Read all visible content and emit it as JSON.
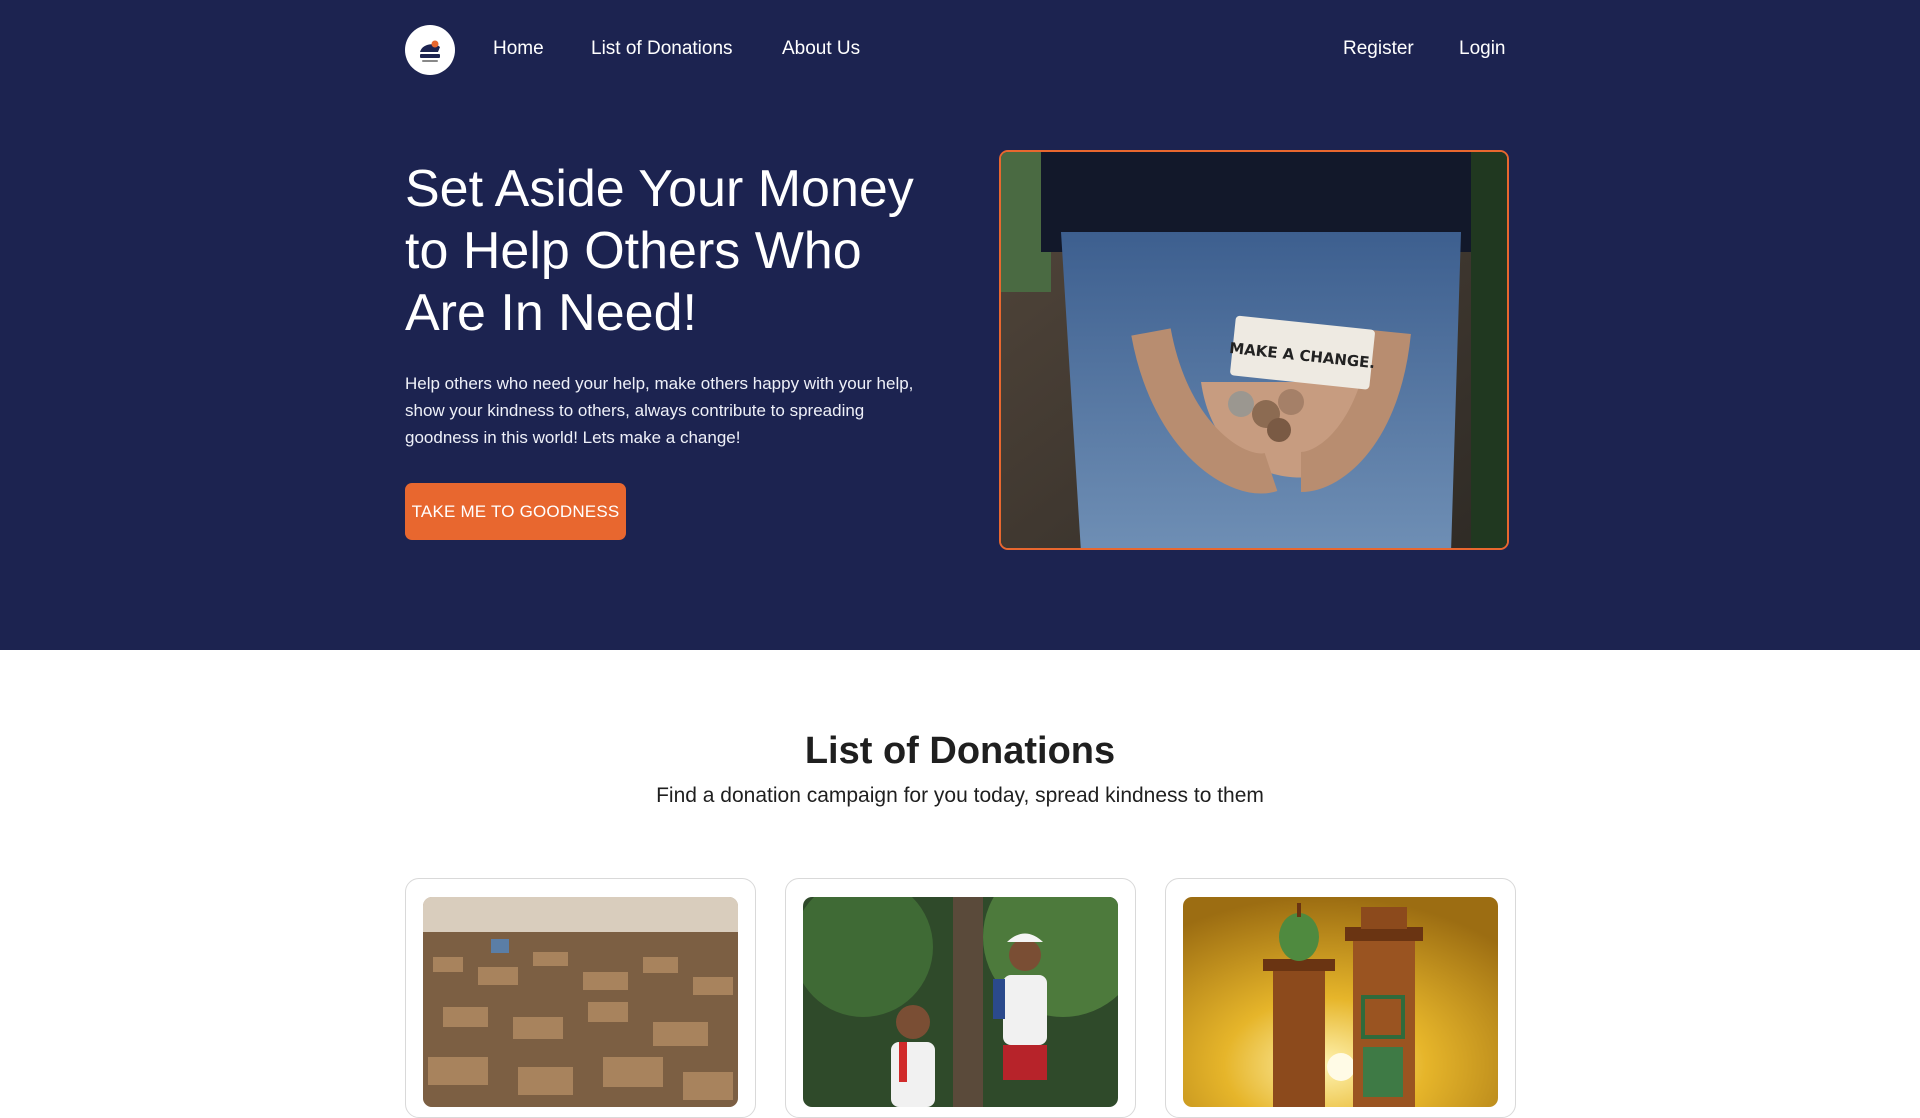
{
  "nav": {
    "logo_icon": "charity-logo-icon",
    "links": [
      "Home",
      "List of Donations",
      "About Us"
    ],
    "register": "Register",
    "login": "Login"
  },
  "hero": {
    "title": "Set Aside Your Money to Help Others Who Are In Need!",
    "description": "Help others who need your help, make others happy with your help, show your kindness to others, always contribute to spreading goodness in this world! Lets make a change!",
    "cta": "TAKE ME TO GOODNESS",
    "image_note": "MAKE A CHANGE."
  },
  "donations": {
    "title": "List of Donations",
    "subtitle": "Find a donation campaign for you today, spread kindness to them"
  },
  "colors": {
    "navy": "#1c2350",
    "accent": "#e8672f"
  }
}
